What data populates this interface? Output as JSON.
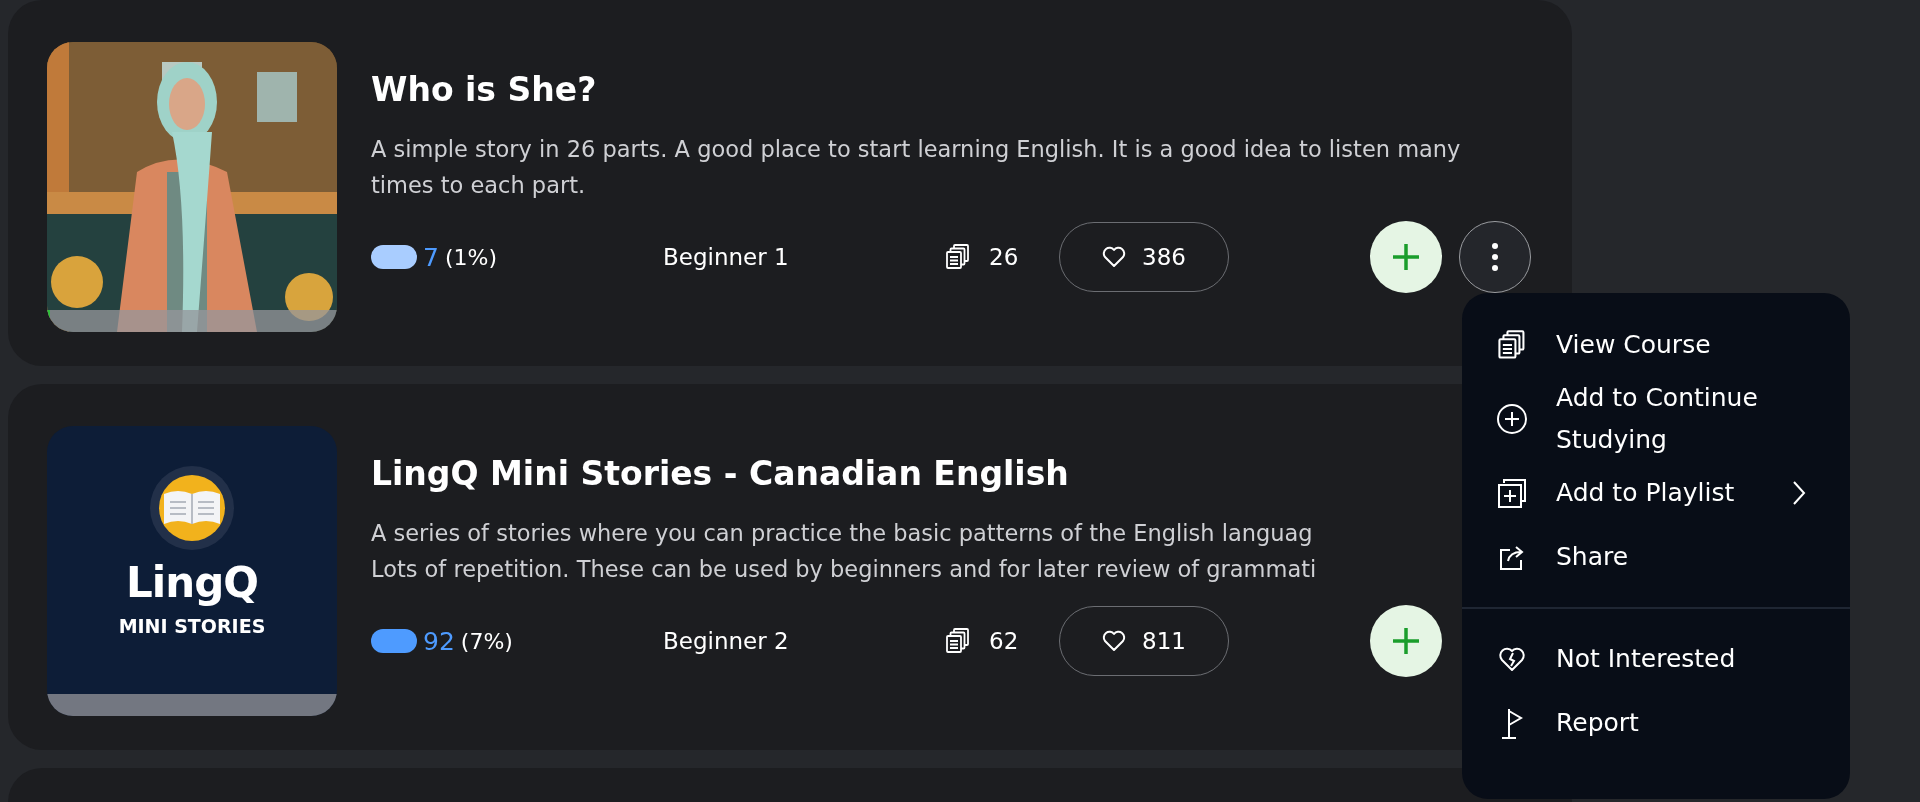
{
  "courses": [
    {
      "title": "Who is She?",
      "description": "A simple story in 26 parts. A good place to start learning English. It is a good idea to listen many times to each part.",
      "cover": {
        "kind": "picture",
        "level": 0.01
      },
      "known": {
        "count": "7",
        "percent": "(1%)",
        "color": "#a9cdff"
      },
      "difficulty": "Beginner 1",
      "lessons": "26",
      "likes": "386",
      "more_button": true
    },
    {
      "title": "LingQ Mini Stories - Canadian English",
      "description": "A series of stories where you can practice the basic patterns of the English languag\nLots of repetition. These can be used by beginners and for later review of grammati",
      "cover": {
        "kind": "logo",
        "brand": "LingQ",
        "subtitle": "MINI STORIES",
        "level": 0
      },
      "known": {
        "count": "92",
        "percent": "(7%)",
        "color": "#4e9bff"
      },
      "difficulty": "Beginner 2",
      "lessons": "62",
      "likes": "811",
      "more_button": false
    },
    {
      "kind": "partial"
    }
  ],
  "menu": {
    "items": [
      {
        "kind": "view",
        "label": "View Course",
        "submenu": false
      },
      {
        "kind": "add",
        "label": "Add to Continue Studying",
        "submenu": false
      },
      {
        "kind": "playlist",
        "label": "Add to Playlist",
        "submenu": true
      },
      {
        "kind": "share",
        "label": "Share",
        "submenu": false
      },
      {
        "kind": "divider"
      },
      {
        "kind": "not_interested",
        "label": "Not Interested",
        "submenu": false
      },
      {
        "kind": "report",
        "label": "Report",
        "submenu": false
      }
    ]
  }
}
